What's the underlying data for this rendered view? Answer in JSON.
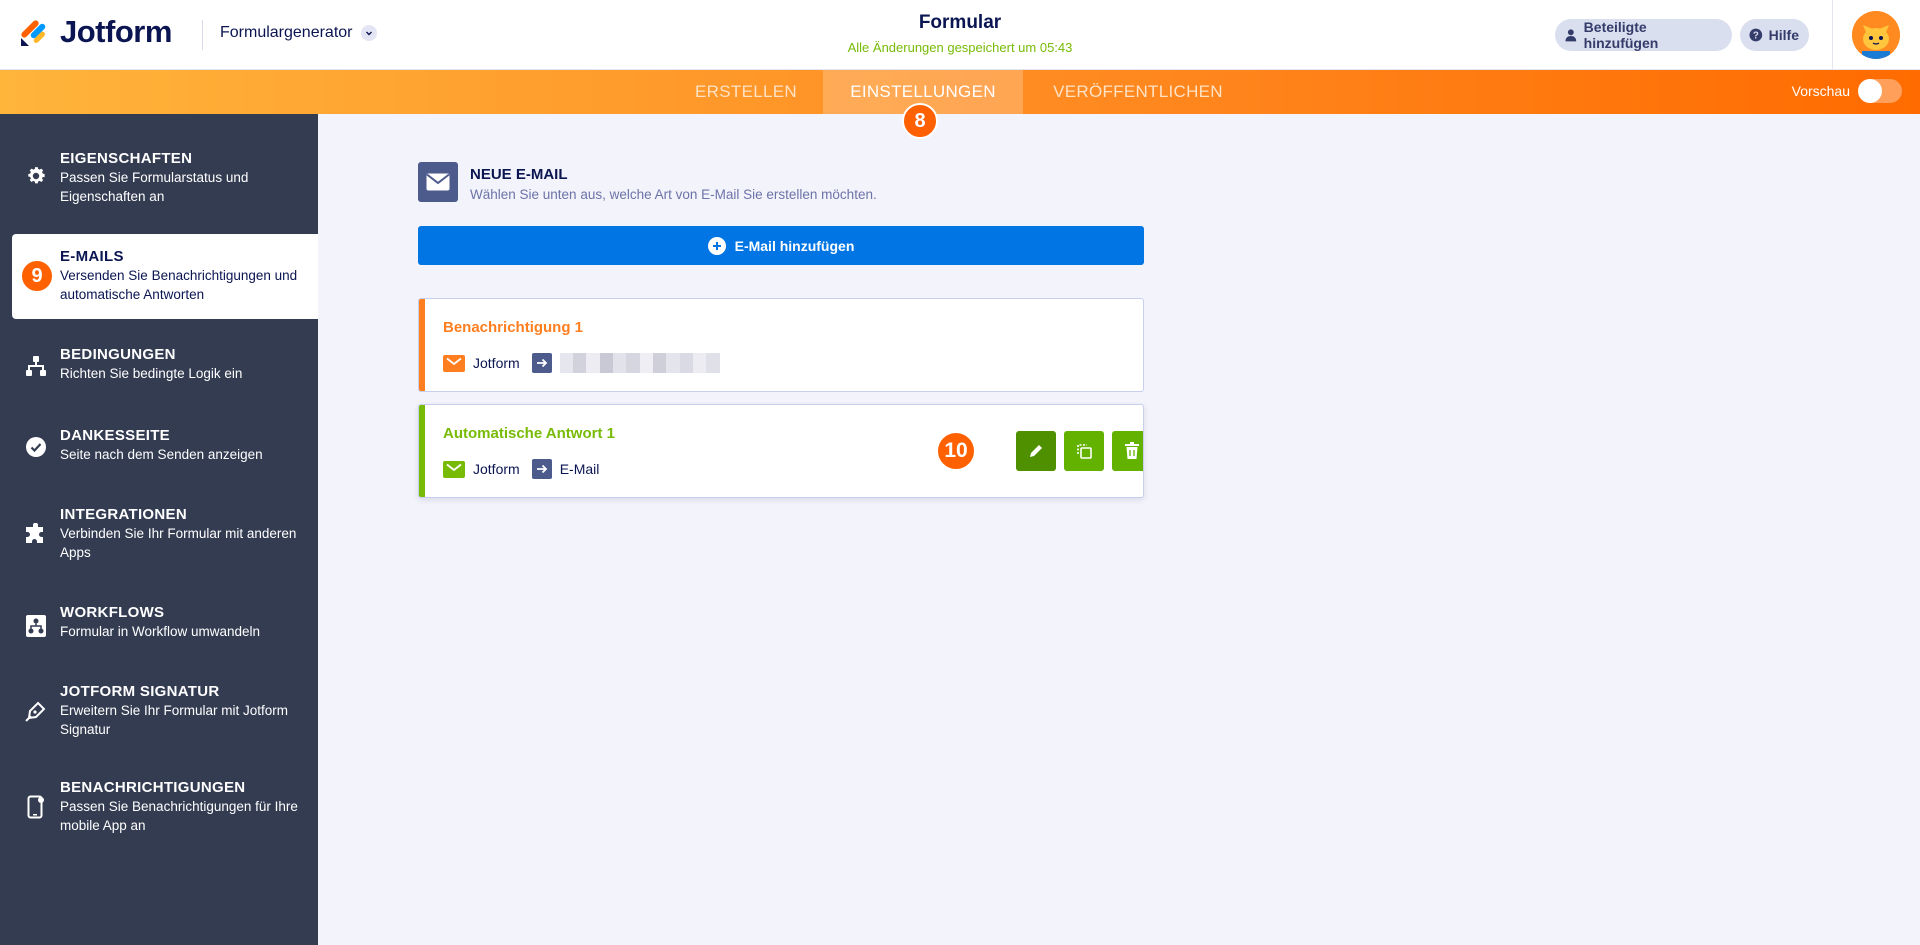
{
  "header": {
    "logo_text": "Jotform",
    "builder_label": "Formulargenerator",
    "form_title": "Formular",
    "saved_status": "Alle Änderungen gespeichert um 05:43",
    "collaborators_label": "Beteiligte hinzufügen",
    "help_label": "Hilfe"
  },
  "nav": {
    "tabs": [
      {
        "label": "ERSTELLEN"
      },
      {
        "label": "EINSTELLUNGEN"
      },
      {
        "label": "VERÖFFENTLICHEN"
      }
    ],
    "preview_label": "Vorschau",
    "preview_on": false,
    "active_tab_badge": "8"
  },
  "sidebar": {
    "active_badge": "9",
    "items": [
      {
        "title": "EIGENSCHAFTEN",
        "desc": "Passen Sie Formularstatus und Eigenschaften an",
        "icon": "gear-icon"
      },
      {
        "title": "E-MAILS",
        "desc": "Versenden Sie Benachrichtigungen und automatische Antworten",
        "icon": "email-icon"
      },
      {
        "title": "BEDINGUNGEN",
        "desc": "Richten Sie bedingte Logik ein",
        "icon": "sitemap-icon"
      },
      {
        "title": "DANKESSEITE",
        "desc": "Seite nach dem Senden anzeigen",
        "icon": "check-circle-icon"
      },
      {
        "title": "INTEGRATIONEN",
        "desc": "Verbinden Sie Ihr Formular mit anderen Apps",
        "icon": "puzzle-icon"
      },
      {
        "title": "WORKFLOWS",
        "desc": "Formular in Workflow umwandeln",
        "icon": "workflow-icon"
      },
      {
        "title": "JOTFORM SIGNATUR",
        "desc": "Erweitern Sie Ihr Formular mit Jotform Signatur",
        "icon": "pen-nib-icon"
      },
      {
        "title": "BENACHRICHTIGUNGEN",
        "desc": "Passen Sie Benachrichtigungen für Ihre mobile App an",
        "icon": "mobile-notification-icon"
      }
    ]
  },
  "main": {
    "new_email_title": "NEUE E-MAIL",
    "new_email_subtitle": "Wählen Sie unten aus, welche Art von E-Mail Sie erstellen möchten.",
    "add_email_label": "E-Mail hinzufügen",
    "actions_badge": "10",
    "emails": [
      {
        "title": "Benachrichtigung 1",
        "from": "Jotform",
        "to": "",
        "accent": "#ff7e1f"
      },
      {
        "title": "Automatische Antwort 1",
        "from": "Jotform",
        "to": "E-Mail",
        "accent": "#78bb07"
      }
    ]
  },
  "colors": {
    "orange": "#ff6100",
    "blue_button": "#0075e3",
    "green": "#64b200",
    "sidebar_bg": "#343c52"
  }
}
